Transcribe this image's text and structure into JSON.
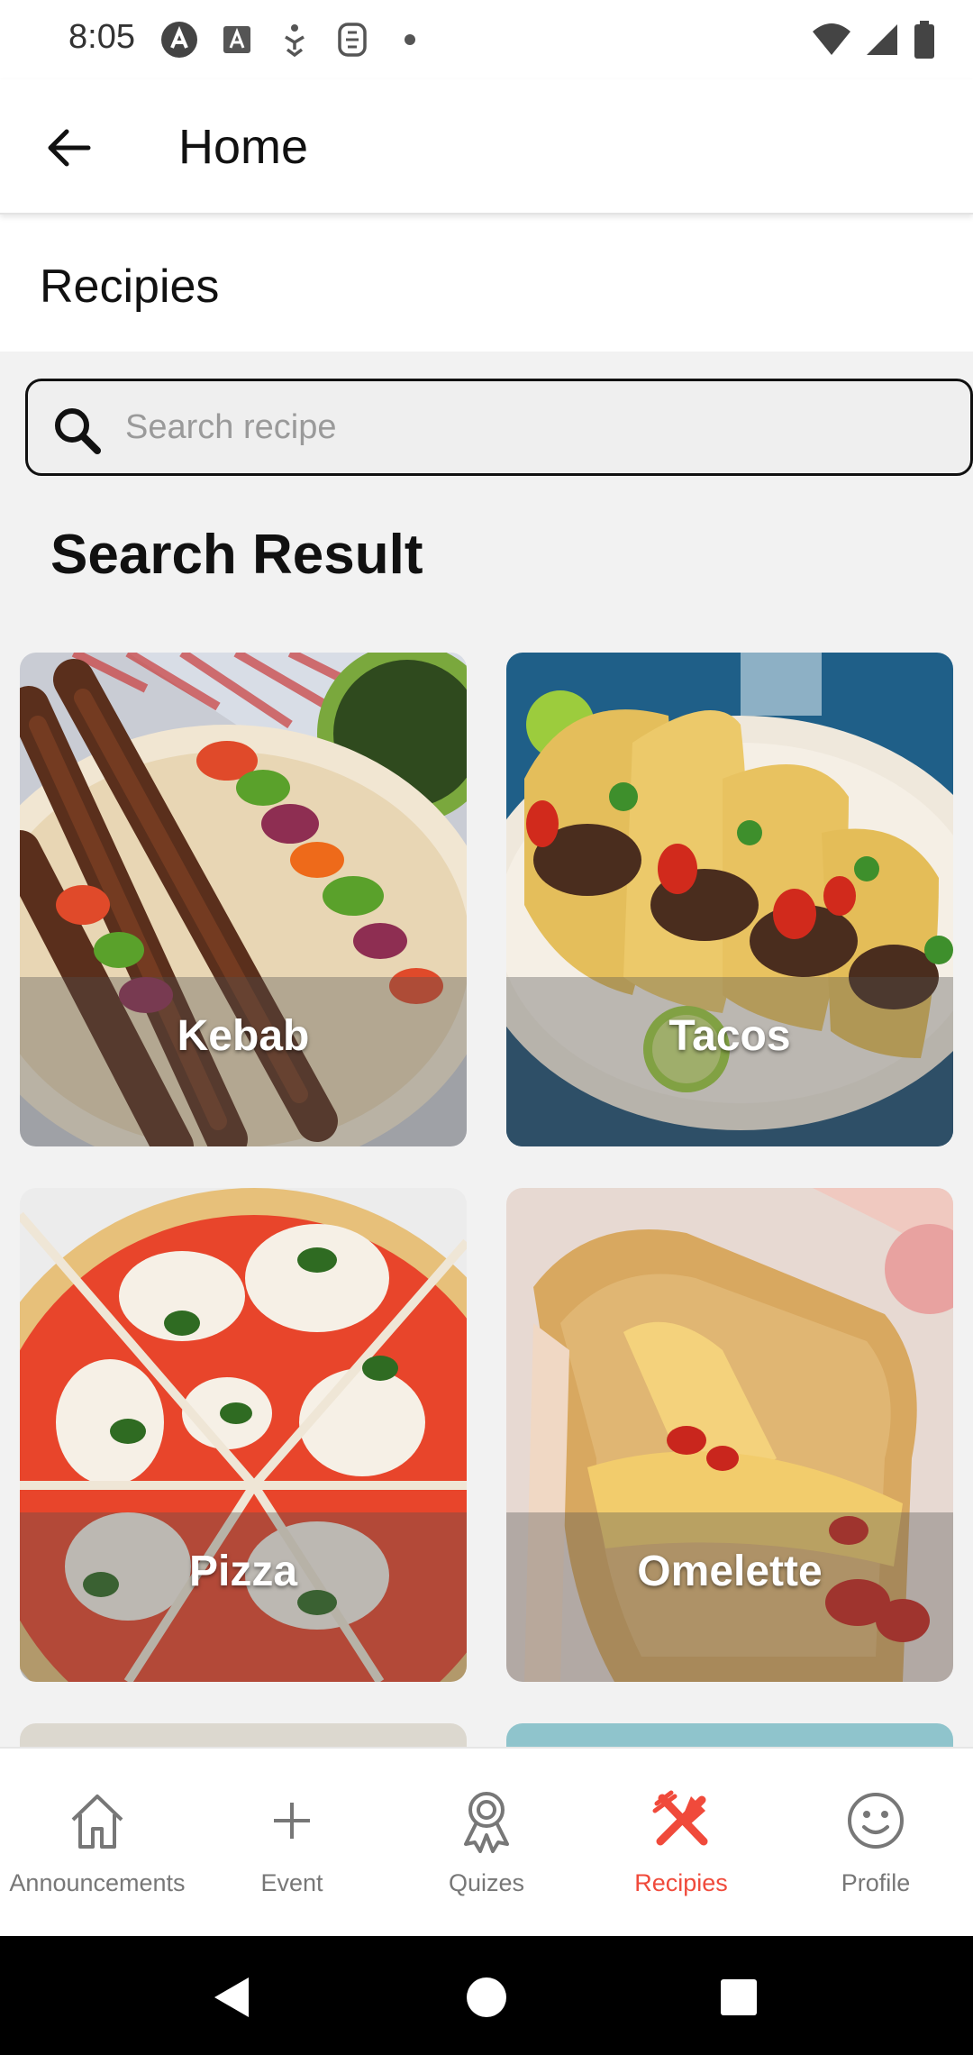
{
  "status_bar": {
    "time": "8:05",
    "left_icons": [
      "android-icon",
      "font-a-icon",
      "accessibility-icon",
      "notification-icon",
      "dot-icon"
    ],
    "right_icons": [
      "wifi-icon",
      "signal-icon",
      "battery-icon"
    ]
  },
  "app_bar": {
    "title": "Home",
    "back_icon": "arrow-back-icon"
  },
  "section": {
    "title": "Recipies"
  },
  "search": {
    "placeholder": "Search recipe",
    "value": ""
  },
  "results": {
    "heading": "Search Result",
    "cards": [
      {
        "label": "Kebab"
      },
      {
        "label": "Tacos"
      },
      {
        "label": "Pizza"
      },
      {
        "label": "Omelette"
      }
    ]
  },
  "bottom_nav": {
    "active_color": "#f04a3b",
    "items": [
      {
        "label": "Announcements",
        "icon": "home-icon",
        "active": false
      },
      {
        "label": "Event",
        "icon": "plus-icon",
        "active": false
      },
      {
        "label": "Quizes",
        "icon": "award-icon",
        "active": false
      },
      {
        "label": "Recipies",
        "icon": "fork-knife-icon",
        "active": true
      },
      {
        "label": "Profile",
        "icon": "smiley-icon",
        "active": false
      }
    ]
  },
  "system_nav": {
    "buttons": [
      "back-triangle-icon",
      "home-circle-icon",
      "recents-square-icon"
    ]
  }
}
